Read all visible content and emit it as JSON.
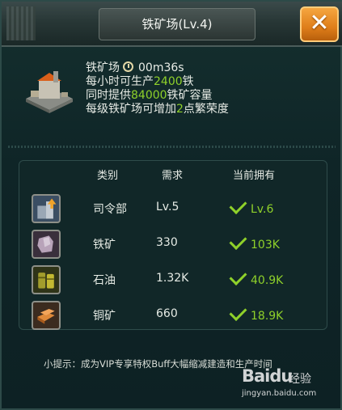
{
  "window": {
    "title": "铁矿场(Lv.4)",
    "close_label": "✕"
  },
  "building": {
    "name": "铁矿场",
    "time": "00m36s",
    "line1_pre": "每小时可生产",
    "line1_val": "2400",
    "line1_post": "铁",
    "line2_pre": "同时提供",
    "line2_val": "84000",
    "line2_post": "铁矿容量",
    "line3_pre": "每级铁矿场可增加",
    "line3_val": "2",
    "line3_post": "点繁荣度"
  },
  "table": {
    "headers": {
      "type": "类别",
      "req": "需求",
      "own": "当前拥有"
    },
    "rows": [
      {
        "name": "司令部",
        "req": "Lv.5",
        "own": "Lv.6",
        "icon": "command-hq-icon"
      },
      {
        "name": "铁矿",
        "req": "330",
        "own": "103K",
        "icon": "iron-ore-icon"
      },
      {
        "name": "石油",
        "req": "1.32K",
        "own": "40.9K",
        "icon": "oil-barrel-icon"
      },
      {
        "name": "铜矿",
        "req": "660",
        "own": "18.9K",
        "icon": "copper-ingot-icon"
      }
    ]
  },
  "tip": "小提示：成为VIP专享特权Buff大幅缩减建造和生产时间",
  "watermark": {
    "logo": "Bai",
    "logo2": "du",
    "jy": "经验",
    "url": "jingyan.baidu.com"
  },
  "colors": {
    "accent_green": "#8fd12a",
    "close_orange": "#f09a30"
  }
}
